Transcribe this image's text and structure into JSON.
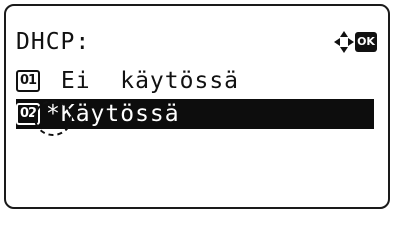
{
  "screen": {
    "title": "DHCP:",
    "ok_label": "OK",
    "nav_icon": "four-way-arrow-icon"
  },
  "options": [
    {
      "number": "01",
      "label": " Ei  käytössä",
      "selected": false
    },
    {
      "number": "02",
      "label": "*Käytössä",
      "selected": true
    }
  ],
  "colors": {
    "foreground": "#111111",
    "background": "#ffffff",
    "highlight": "#0d0d0d"
  }
}
